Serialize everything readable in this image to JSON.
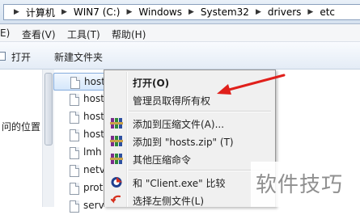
{
  "address": {
    "crumbs": [
      "计算机",
      "WIN7 (C:)",
      "Windows",
      "System32",
      "drivers",
      "etc"
    ],
    "separator": "▶"
  },
  "menubar": {
    "items": [
      "E)",
      "查看(V)",
      "工具(T)",
      "帮助(H)"
    ]
  },
  "toolbar": {
    "open_label": "打开",
    "new_folder_label": "新建文件夹"
  },
  "navpane": {
    "partial_text": "问的位置"
  },
  "files": [
    {
      "name": "host",
      "selected": true
    },
    {
      "name": "host",
      "selected": false
    },
    {
      "name": "host",
      "selected": false
    },
    {
      "name": "host",
      "selected": false
    },
    {
      "name": "lmh",
      "selected": false
    },
    {
      "name": "netv",
      "selected": false
    },
    {
      "name": "prot",
      "selected": false
    },
    {
      "name": "serv",
      "selected": false
    }
  ],
  "context_menu": {
    "items": [
      {
        "label": "打开(O)",
        "bold": true,
        "icon": "none"
      },
      {
        "label": "管理员取得所有权",
        "bold": false,
        "icon": "none"
      },
      {
        "label": "添加到压缩文件(A)...",
        "bold": false,
        "icon": "winrar-books-icon"
      },
      {
        "label": "添加到 \"hosts.zip\" (T)",
        "bold": false,
        "icon": "winrar-books-icon"
      },
      {
        "label": "其他压缩命令",
        "bold": false,
        "icon": "winrar-books-icon"
      },
      {
        "label": "和 \"Client.exe\" 比较",
        "bold": false,
        "icon": "compare-icon"
      },
      {
        "label": "选择左侧文件(L)",
        "bold": false,
        "icon": "select-left-icon"
      }
    ]
  },
  "annotation": {
    "arrow_color": "#e0201b"
  },
  "watermark": {
    "text": "软件技巧"
  }
}
